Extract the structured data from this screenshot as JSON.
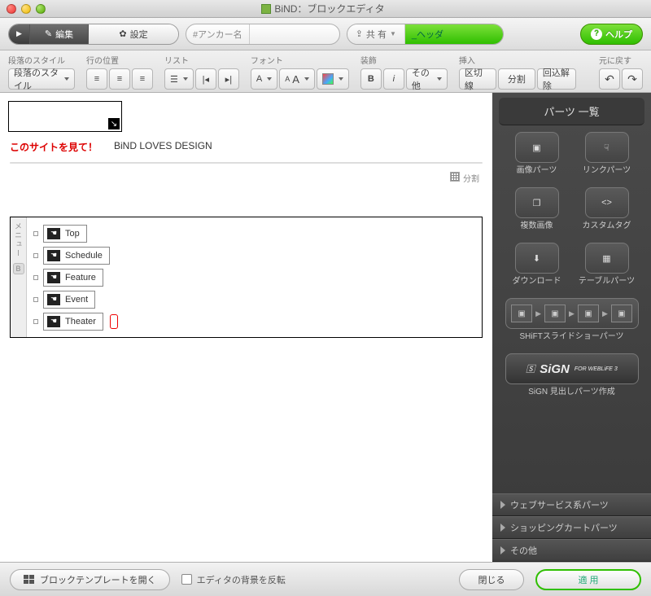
{
  "window": {
    "title": "BiND：ブロックエディタ"
  },
  "topbar": {
    "edit": "編集",
    "settings": "設定",
    "anchor_label": "#アンカー名",
    "anchor_value": "",
    "share": "共 有",
    "share_value": "_ヘッダ",
    "help": "ヘルプ"
  },
  "fmt": {
    "para_style_label": "段落のスタイル",
    "para_style_value": "段落のスタイル",
    "line_pos_label": "行の位置",
    "list_label": "リスト",
    "font_label": "フォント",
    "decor_label": "装飾",
    "decor_other": "その他",
    "insert_label": "挿入",
    "insert_hr": "区切線",
    "insert_split": "分割",
    "insert_unwrap": "回込解除",
    "undo_label": "元に戻す"
  },
  "canvas": {
    "subtitle_red": "このサイトを見て！",
    "subtitle_black": "BiND LOVES DESIGN",
    "split_caption": "分割",
    "menu_tab": "メニュー",
    "menu_b": "B",
    "menu_items": [
      "Top",
      "Schedule",
      "Feature",
      "Event",
      "Theater"
    ]
  },
  "side": {
    "title": "パーツ 一覧",
    "parts": {
      "image": "画像パーツ",
      "link": "リンクパーツ",
      "multi": "複数画像",
      "custom": "カスタムタグ",
      "download": "ダウンロード",
      "table": "テーブルパーツ",
      "slideshow": "SHiFTスライドショーパーツ",
      "sign_logo": "SiGN",
      "sign_sub": "FOR WEBLiFE 3",
      "sign": "SiGN 見出しパーツ作成"
    },
    "acc": {
      "web": "ウェブサービス系パーツ",
      "cart": "ショッピングカートパーツ",
      "other": "その他"
    }
  },
  "bottom": {
    "template": "ブロックテンプレートを開く",
    "invert": "エディタの背景を反転",
    "close": "閉じる",
    "apply": "適 用"
  }
}
